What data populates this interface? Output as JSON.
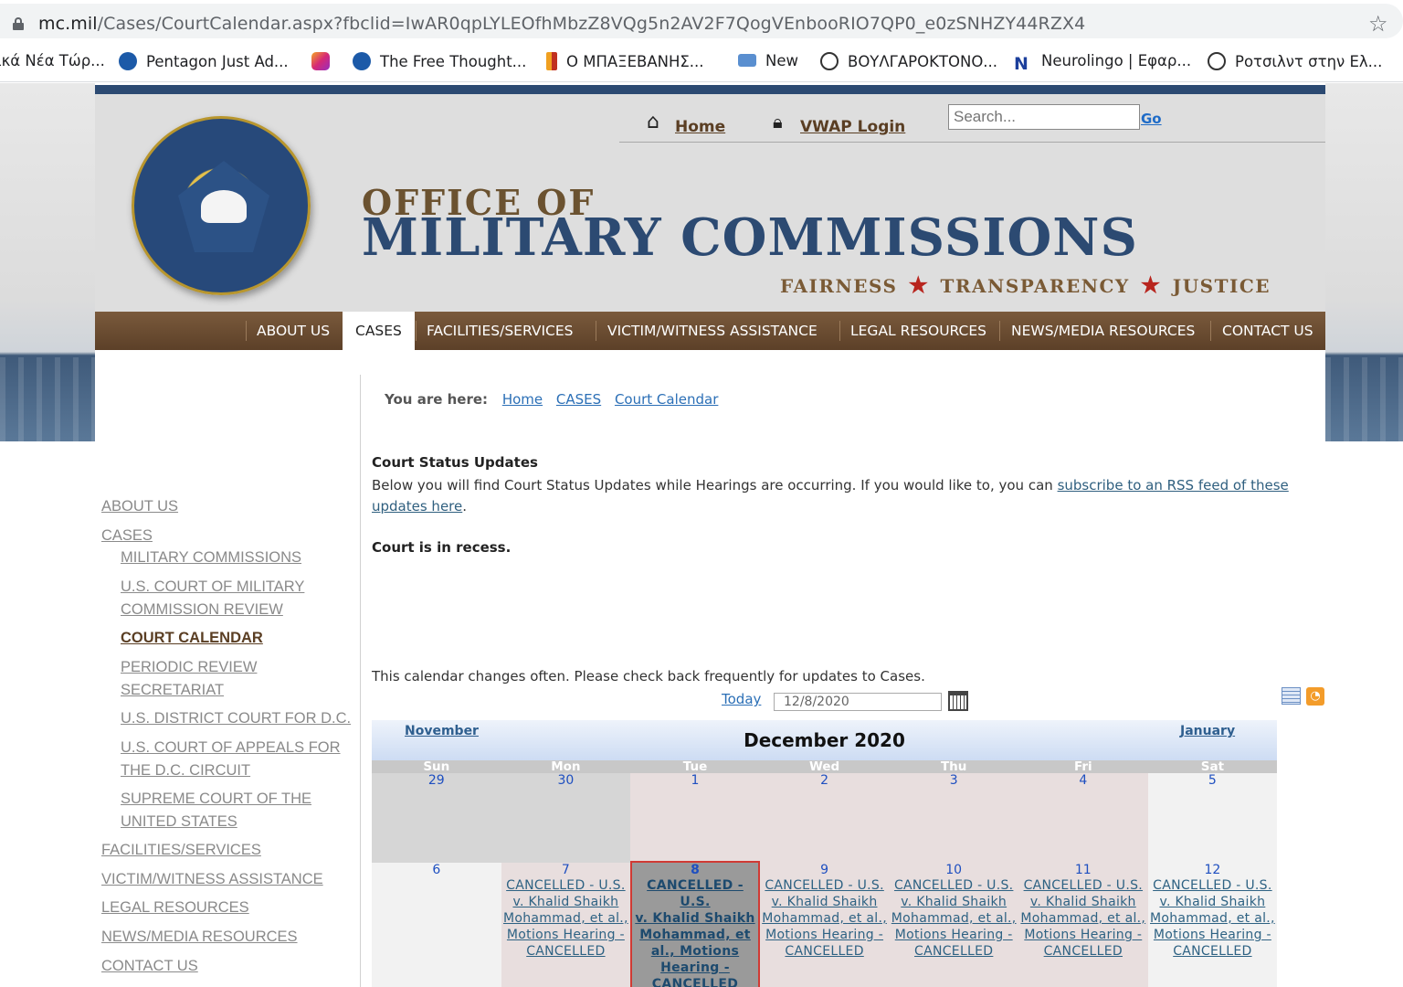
{
  "browser": {
    "url_host": "mc.mil",
    "url_path": "/Cases/CourtCalendar.aspx?fbclid=IwAR0qpLYLEOfhMbzZ8VQg5n2AV2F7QogVEnbooRIO7QP0_e0zSNHZY44RZX4",
    "bookmarks": [
      "ικά Νέα Τώρ...",
      "Pentagon Just Ad...",
      "",
      "The Free Thought...",
      "Ο ΜΠΑΞΕΒΑΝΗΣ...",
      "New",
      "ΒΟΥΛΓΑΡΟΚΤΟΝΟ...",
      "Neurolingo | Εφαρ...",
      "Ροτσιλντ στην Ελ..."
    ]
  },
  "header": {
    "home_label": "Home",
    "vwap_label": "VWAP Login",
    "search_placeholder": "Search...",
    "go_label": "Go",
    "title_line1": "OFFICE OF",
    "title_line2": "MILITARY COMMISSIONS",
    "motto": [
      "FAIRNESS",
      "TRANSPARENCY",
      "JUSTICE"
    ]
  },
  "mainnav": [
    "ABOUT US",
    "CASES",
    "FACILITIES/SERVICES",
    "VICTIM/WITNESS ASSISTANCE",
    "LEGAL RESOURCES",
    "NEWS/MEDIA RESOURCES",
    "CONTACT US"
  ],
  "leftnav": {
    "about": "ABOUT US",
    "cases": "CASES",
    "mil_comm": "MILITARY COMMISSIONS",
    "uscmcr_1": "U.S. COURT OF MILITARY",
    "uscmcr_2": "COMMISSION REVIEW",
    "court_cal": "COURT CALENDAR",
    "prs_1": "PERIODIC REVIEW",
    "prs_2": "SECRETARIAT",
    "usdc": "U.S. DISTRICT COURT FOR D.C.",
    "usca_1": "U.S. COURT OF APPEALS FOR",
    "usca_2": "THE D.C. CIRCUIT",
    "scotus_1": "SUPREME COURT OF THE",
    "scotus_2": "UNITED STATES",
    "facilities": "FACILITIES/SERVICES",
    "victim": "VICTIM/WITNESS ASSISTANCE",
    "legal": "LEGAL RESOURCES",
    "news": "NEWS/MEDIA RESOURCES",
    "contact": "CONTACT US"
  },
  "breadcrumb": {
    "label": "You are here:",
    "home": "Home",
    "cases": "CASES",
    "current": "Court Calendar"
  },
  "status": {
    "heading": "Court Status Updates",
    "text": "Below you will find Court Status Updates while Hearings are occurring. If you would like to, you can ",
    "link": "subscribe to an RSS feed of these updates here",
    "text_end": ".",
    "recess": "Court is in recess."
  },
  "calendar": {
    "note": "This calendar changes often. Please check back frequently for updates to Cases.",
    "today_label": "Today",
    "date_value": "12/8/2020",
    "prev": "November",
    "next": "January",
    "title": "December 2020",
    "days": [
      "Sun",
      "Mon",
      "Tue",
      "Wed",
      "Thu",
      "Fri",
      "Sat"
    ],
    "week1": [
      "29",
      "30",
      "1",
      "2",
      "3",
      "4",
      "5"
    ],
    "week2": [
      "6",
      "7",
      "8",
      "9",
      "10",
      "11",
      "12"
    ],
    "event_lines": [
      "CANCELLED - U.S.",
      "v. Khalid Shaikh",
      "Mohammad, et al.,",
      "Motions Hearing -",
      "CANCELLED"
    ],
    "event_lines_selected": [
      "CANCELLED - U.S.",
      "v. Khalid Shaikh",
      "Mohammad, et",
      "al., Motions",
      "Hearing -",
      "CANCELLED"
    ],
    "colors": {
      "other_month": "#d6d6d6",
      "weekday": "#e8dede",
      "weekend": "#f2f2f2",
      "selected_border": "#d03a34"
    }
  }
}
